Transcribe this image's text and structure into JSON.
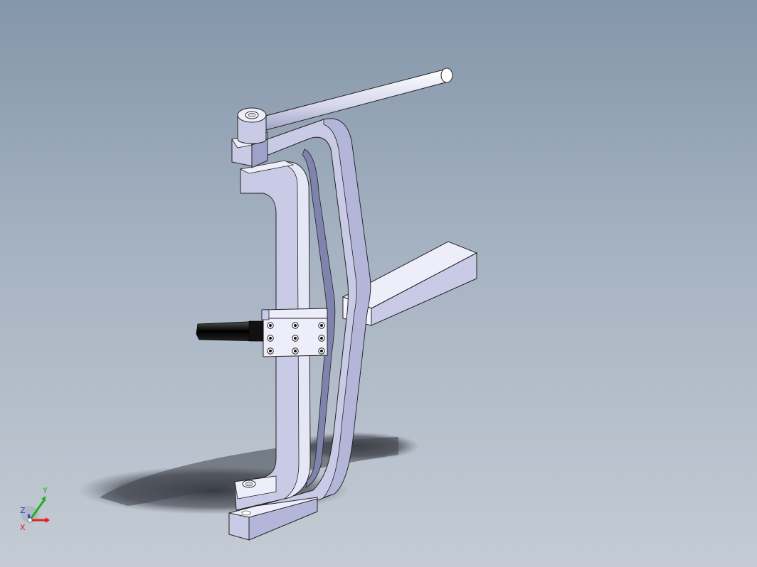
{
  "viewport": {
    "description_free": true
  },
  "triad": {
    "x_label": "X",
    "y_label": "Y",
    "z_label": "Z",
    "x_color": "#e02020",
    "y_color": "#20b020",
    "z_color": "#2040e0"
  },
  "colors": {
    "background_top": "#8496aa",
    "background_bottom": "#c4cbd4",
    "part_face": "#c9cbe6",
    "part_light": "#eeeefa",
    "part_dark": "#9fa2c8",
    "shadow": "#3b3f46",
    "pin": "#111111"
  }
}
